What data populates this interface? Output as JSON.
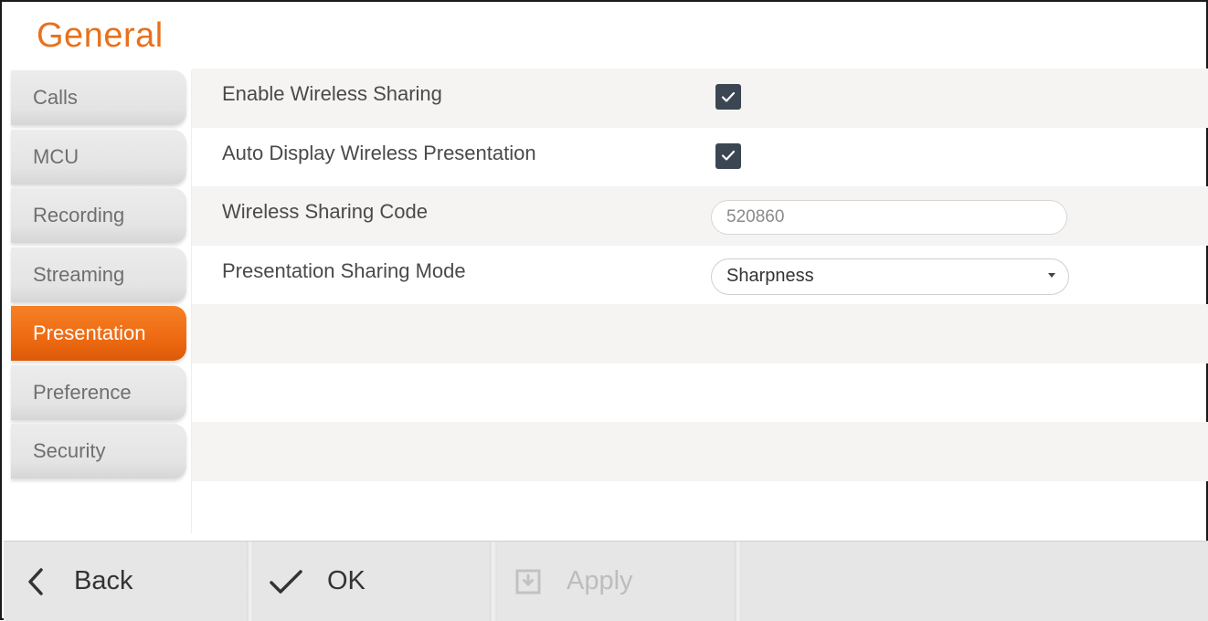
{
  "page": {
    "title": "General"
  },
  "sidebar": {
    "items": [
      {
        "label": "Calls",
        "active": false
      },
      {
        "label": "MCU",
        "active": false
      },
      {
        "label": "Recording",
        "active": false
      },
      {
        "label": "Streaming",
        "active": false
      },
      {
        "label": "Presentation",
        "active": true
      },
      {
        "label": "Preference",
        "active": false
      },
      {
        "label": "Security",
        "active": false
      }
    ]
  },
  "settings": {
    "enable_wireless_sharing": {
      "label": "Enable Wireless Sharing",
      "checked": true
    },
    "auto_display_wireless_presentation": {
      "label": "Auto Display Wireless Presentation",
      "checked": true
    },
    "wireless_sharing_code": {
      "label": "Wireless Sharing Code",
      "value": "520860"
    },
    "presentation_sharing_mode": {
      "label": "Presentation Sharing Mode",
      "selected": "Sharpness"
    }
  },
  "footer": {
    "back_label": "Back",
    "ok_label": "OK",
    "apply_label": "Apply",
    "apply_enabled": false
  },
  "colors": {
    "accent": "#f07020",
    "checkbox": "#3b4652",
    "title": "#e8711d"
  },
  "icons": {
    "back": "chevron-left-icon",
    "ok": "checkmark-icon",
    "apply": "save-icon",
    "dropdown": "caret-down-icon"
  }
}
